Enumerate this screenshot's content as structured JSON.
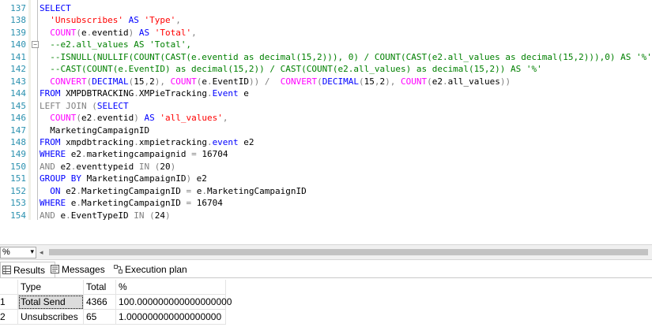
{
  "editor": {
    "lines": [
      {
        "num": "137",
        "parts": [
          [
            "kw",
            "SELECT"
          ]
        ]
      },
      {
        "num": "138",
        "parts": [
          [
            "pl",
            "  "
          ],
          [
            "str",
            "'Unsubscribes'"
          ],
          [
            "pl",
            " "
          ],
          [
            "kw",
            "AS"
          ],
          [
            "pl",
            " "
          ],
          [
            "str",
            "'Type'"
          ],
          [
            "gr",
            ","
          ]
        ]
      },
      {
        "num": "139",
        "parts": [
          [
            "pl",
            "  "
          ],
          [
            "fn",
            "COUNT"
          ],
          [
            "gr",
            "("
          ],
          [
            "pl",
            "e"
          ],
          [
            "gr",
            "."
          ],
          [
            "pl",
            "eventid"
          ],
          [
            "gr",
            ")"
          ],
          [
            "pl",
            " "
          ],
          [
            "kw",
            "AS"
          ],
          [
            "pl",
            " "
          ],
          [
            "str",
            "'Total'"
          ],
          [
            "gr",
            ","
          ]
        ]
      },
      {
        "num": "140",
        "fold": "−",
        "parts": [
          [
            "pl",
            "  "
          ],
          [
            "cm",
            "--e2.all_values AS 'Total',"
          ]
        ]
      },
      {
        "num": "141",
        "parts": [
          [
            "pl",
            "  "
          ],
          [
            "cm",
            "--ISNULL(NULLIF(COUNT(CAST(e.eventid as decimal(15,2))), 0) / COUNT(CAST(e2.all_values as decimal(15,2))),0) AS '%',"
          ]
        ]
      },
      {
        "num": "142",
        "parts": [
          [
            "pl",
            "  "
          ],
          [
            "cm",
            "--CAST(COUNT(e.EventID) as decimal(15,2)) / CAST(COUNT(e2.all_values) as decimal(15,2)) AS '%'"
          ]
        ]
      },
      {
        "num": "143",
        "parts": [
          [
            "pl",
            "  "
          ],
          [
            "fn",
            "CONVERT"
          ],
          [
            "gr",
            "("
          ],
          [
            "kw",
            "DECIMAL"
          ],
          [
            "gr",
            "("
          ],
          [
            "pl",
            "15"
          ],
          [
            "gr",
            ","
          ],
          [
            "pl",
            "2"
          ],
          [
            "gr",
            "),"
          ],
          [
            "pl",
            " "
          ],
          [
            "fn",
            "COUNT"
          ],
          [
            "gr",
            "("
          ],
          [
            "pl",
            "e"
          ],
          [
            "gr",
            "."
          ],
          [
            "pl",
            "EventID"
          ],
          [
            "gr",
            "))"
          ],
          [
            "pl",
            " "
          ],
          [
            "gr",
            "/"
          ],
          [
            "pl",
            "  "
          ],
          [
            "fn",
            "CONVERT"
          ],
          [
            "gr",
            "("
          ],
          [
            "kw",
            "DECIMAL"
          ],
          [
            "gr",
            "("
          ],
          [
            "pl",
            "15"
          ],
          [
            "gr",
            ","
          ],
          [
            "pl",
            "2"
          ],
          [
            "gr",
            "),"
          ],
          [
            "pl",
            " "
          ],
          [
            "fn",
            "COUNT"
          ],
          [
            "gr",
            "("
          ],
          [
            "pl",
            "e2"
          ],
          [
            "gr",
            "."
          ],
          [
            "pl",
            "all_values"
          ],
          [
            "gr",
            "))"
          ]
        ]
      },
      {
        "num": "144",
        "parts": [
          [
            "kw",
            "FROM"
          ],
          [
            "pl",
            " XMPDBTRACKING"
          ],
          [
            "gr",
            "."
          ],
          [
            "pl",
            "XMPieTracking"
          ],
          [
            "gr",
            "."
          ],
          [
            "kw",
            "Event"
          ],
          [
            "pl",
            " e"
          ]
        ]
      },
      {
        "num": "145",
        "parts": [
          [
            "gr",
            "LEFT JOIN"
          ],
          [
            "pl",
            " "
          ],
          [
            "gr",
            "("
          ],
          [
            "kw",
            "SELECT"
          ]
        ]
      },
      {
        "num": "146",
        "parts": [
          [
            "pl",
            "  "
          ],
          [
            "fn",
            "COUNT"
          ],
          [
            "gr",
            "("
          ],
          [
            "pl",
            "e2"
          ],
          [
            "gr",
            "."
          ],
          [
            "pl",
            "eventid"
          ],
          [
            "gr",
            ")"
          ],
          [
            "pl",
            " "
          ],
          [
            "kw",
            "AS"
          ],
          [
            "pl",
            " "
          ],
          [
            "str",
            "'all_values'"
          ],
          [
            "gr",
            ","
          ]
        ]
      },
      {
        "num": "147",
        "parts": [
          [
            "pl",
            "  MarketingCampaignID"
          ]
        ]
      },
      {
        "num": "148",
        "parts": [
          [
            "kw",
            "FROM"
          ],
          [
            "pl",
            " xmpdbtracking"
          ],
          [
            "gr",
            "."
          ],
          [
            "pl",
            "xmpietracking"
          ],
          [
            "gr",
            "."
          ],
          [
            "kw",
            "event"
          ],
          [
            "pl",
            " e2"
          ]
        ]
      },
      {
        "num": "149",
        "parts": [
          [
            "kw",
            "WHERE"
          ],
          [
            "pl",
            " e2"
          ],
          [
            "gr",
            "."
          ],
          [
            "pl",
            "marketingcampaignid "
          ],
          [
            "gr",
            "="
          ],
          [
            "pl",
            " 16704"
          ]
        ]
      },
      {
        "num": "150",
        "parts": [
          [
            "gr",
            "AND"
          ],
          [
            "pl",
            " e2"
          ],
          [
            "gr",
            "."
          ],
          [
            "pl",
            "eventtypeid "
          ],
          [
            "gr",
            "IN"
          ],
          [
            "pl",
            " "
          ],
          [
            "gr",
            "("
          ],
          [
            "pl",
            "20"
          ],
          [
            "gr",
            ")"
          ]
        ]
      },
      {
        "num": "151",
        "parts": [
          [
            "kw",
            "GROUP BY"
          ],
          [
            "pl",
            " MarketingCampaignID"
          ],
          [
            "gr",
            ")"
          ],
          [
            "pl",
            " e2"
          ]
        ]
      },
      {
        "num": "152",
        "parts": [
          [
            "pl",
            "  "
          ],
          [
            "kw",
            "ON"
          ],
          [
            "pl",
            " e2"
          ],
          [
            "gr",
            "."
          ],
          [
            "pl",
            "MarketingCampaignID "
          ],
          [
            "gr",
            "="
          ],
          [
            "pl",
            " e"
          ],
          [
            "gr",
            "."
          ],
          [
            "pl",
            "MarketingCampaignID"
          ]
        ]
      },
      {
        "num": "153",
        "parts": [
          [
            "kw",
            "WHERE"
          ],
          [
            "pl",
            " e"
          ],
          [
            "gr",
            "."
          ],
          [
            "pl",
            "MarketingCampaignID "
          ],
          [
            "gr",
            "="
          ],
          [
            "pl",
            " 16704"
          ]
        ]
      },
      {
        "num": "154",
        "parts": [
          [
            "gr",
            "AND"
          ],
          [
            "pl",
            " e"
          ],
          [
            "gr",
            "."
          ],
          [
            "pl",
            "EventTypeID "
          ],
          [
            "gr",
            "IN"
          ],
          [
            "pl",
            " "
          ],
          [
            "gr",
            "("
          ],
          [
            "pl",
            "24"
          ],
          [
            "gr",
            ")"
          ]
        ]
      }
    ]
  },
  "statusbar": {
    "zoom": "%",
    "zoom_arrow": "▾",
    "scroll_left": "◂"
  },
  "tabs": [
    {
      "label": "Results",
      "icon": "grid-icon",
      "active": true
    },
    {
      "label": "Messages",
      "icon": "messages-icon",
      "active": false
    },
    {
      "label": "Execution plan",
      "icon": "execution-plan-icon",
      "active": false
    }
  ],
  "results": {
    "columns": [
      "Type",
      "Total",
      "%"
    ],
    "rows": [
      {
        "rownum": "1",
        "cells": [
          "Total Send",
          "4366",
          "100.000000000000000000"
        ]
      },
      {
        "rownum": "2",
        "cells": [
          "Unsubscribes",
          "65",
          "1.000000000000000000"
        ]
      }
    ]
  },
  "colors": {
    "keyword": "#0000ff",
    "function": "#ff00ff",
    "string": "#ff0000",
    "comment": "#008000",
    "operator": "#808080",
    "line_number": "#2b91af"
  }
}
